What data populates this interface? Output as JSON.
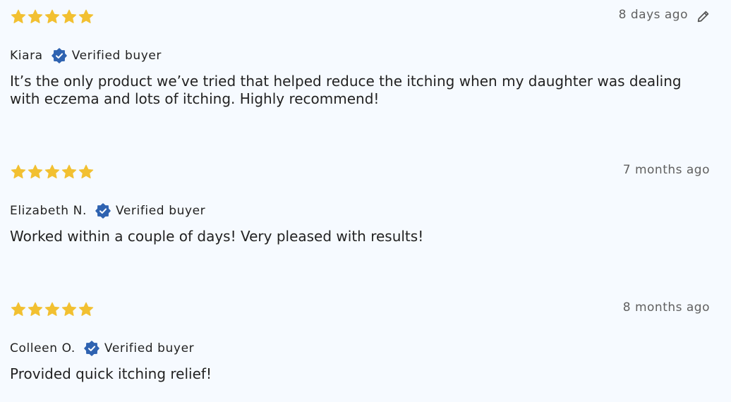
{
  "colors": {
    "star": "#f2c031",
    "verified_badge": "#2f63b1",
    "background": "#f6faff",
    "date_text": "#606060"
  },
  "reviews": [
    {
      "rating": 5,
      "date": "8 days ago",
      "editable": true,
      "edit_icon": "pencil-icon",
      "author": "Kiara",
      "verified_label": "Verified buyer",
      "verified_icon": "verified-badge-icon",
      "body": "It’s the only product we’ve tried that helped reduce the itching when my daughter was dealing with eczema and lots of itching. Highly recommend!"
    },
    {
      "rating": 5,
      "date": "7 months ago",
      "editable": false,
      "author": "Elizabeth N.",
      "verified_label": "Verified buyer",
      "verified_icon": "verified-badge-icon",
      "body": "Worked within a couple of days! Very pleased with results!"
    },
    {
      "rating": 5,
      "date": "8 months ago",
      "editable": false,
      "author": "Colleen O.",
      "verified_label": "Verified buyer",
      "verified_icon": "verified-badge-icon",
      "body": "Provided quick itching relief!"
    }
  ]
}
